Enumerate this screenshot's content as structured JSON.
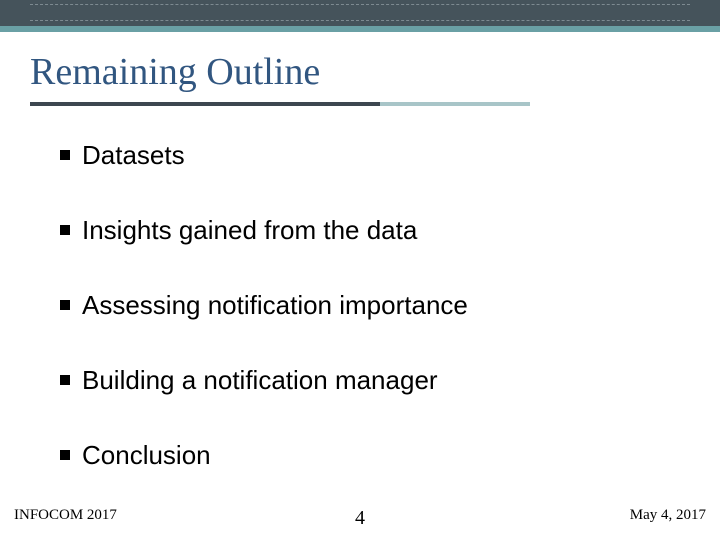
{
  "title": "Remaining Outline",
  "bullets": [
    "Datasets",
    "Insights gained from the data",
    "Assessing notification importance",
    "Building a notification manager",
    "Conclusion"
  ],
  "footer": {
    "left": "INFOCOM 2017",
    "center": "4",
    "right": "May 4, 2017"
  },
  "colors": {
    "topband": "#45535b",
    "teal": "#6aa0a5",
    "title": "#315680"
  }
}
